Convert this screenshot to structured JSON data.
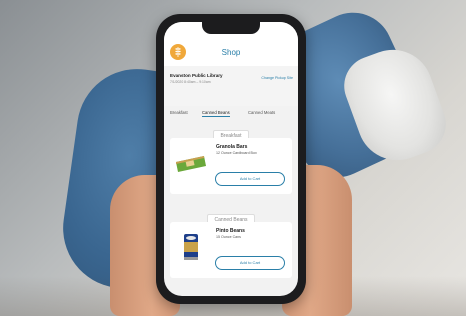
{
  "app": {
    "title": "Shop",
    "logo_icon": "wheat-icon",
    "accent_color": "#2a7fa8"
  },
  "pickup": {
    "location_name": "Evanston Public Library",
    "time_window": "7/1/2020 8:40am – 9:10am",
    "change_label": "Change Pickup Site"
  },
  "tabs": [
    {
      "label": "Breakfast",
      "active": false
    },
    {
      "label": "Canned Beans",
      "active": true
    },
    {
      "label": "Canned Meats",
      "active": false
    }
  ],
  "sections": [
    {
      "heading": "Breakfast",
      "product": {
        "name": "Granola Bars",
        "description": "12 Ounce Cardboard Box",
        "button_label": "Add to Cart"
      }
    },
    {
      "heading": "Canned Beans",
      "product": {
        "name": "Pinto Beans",
        "description": "15 Ounce Cans",
        "button_label": "Add to Cart"
      }
    }
  ]
}
